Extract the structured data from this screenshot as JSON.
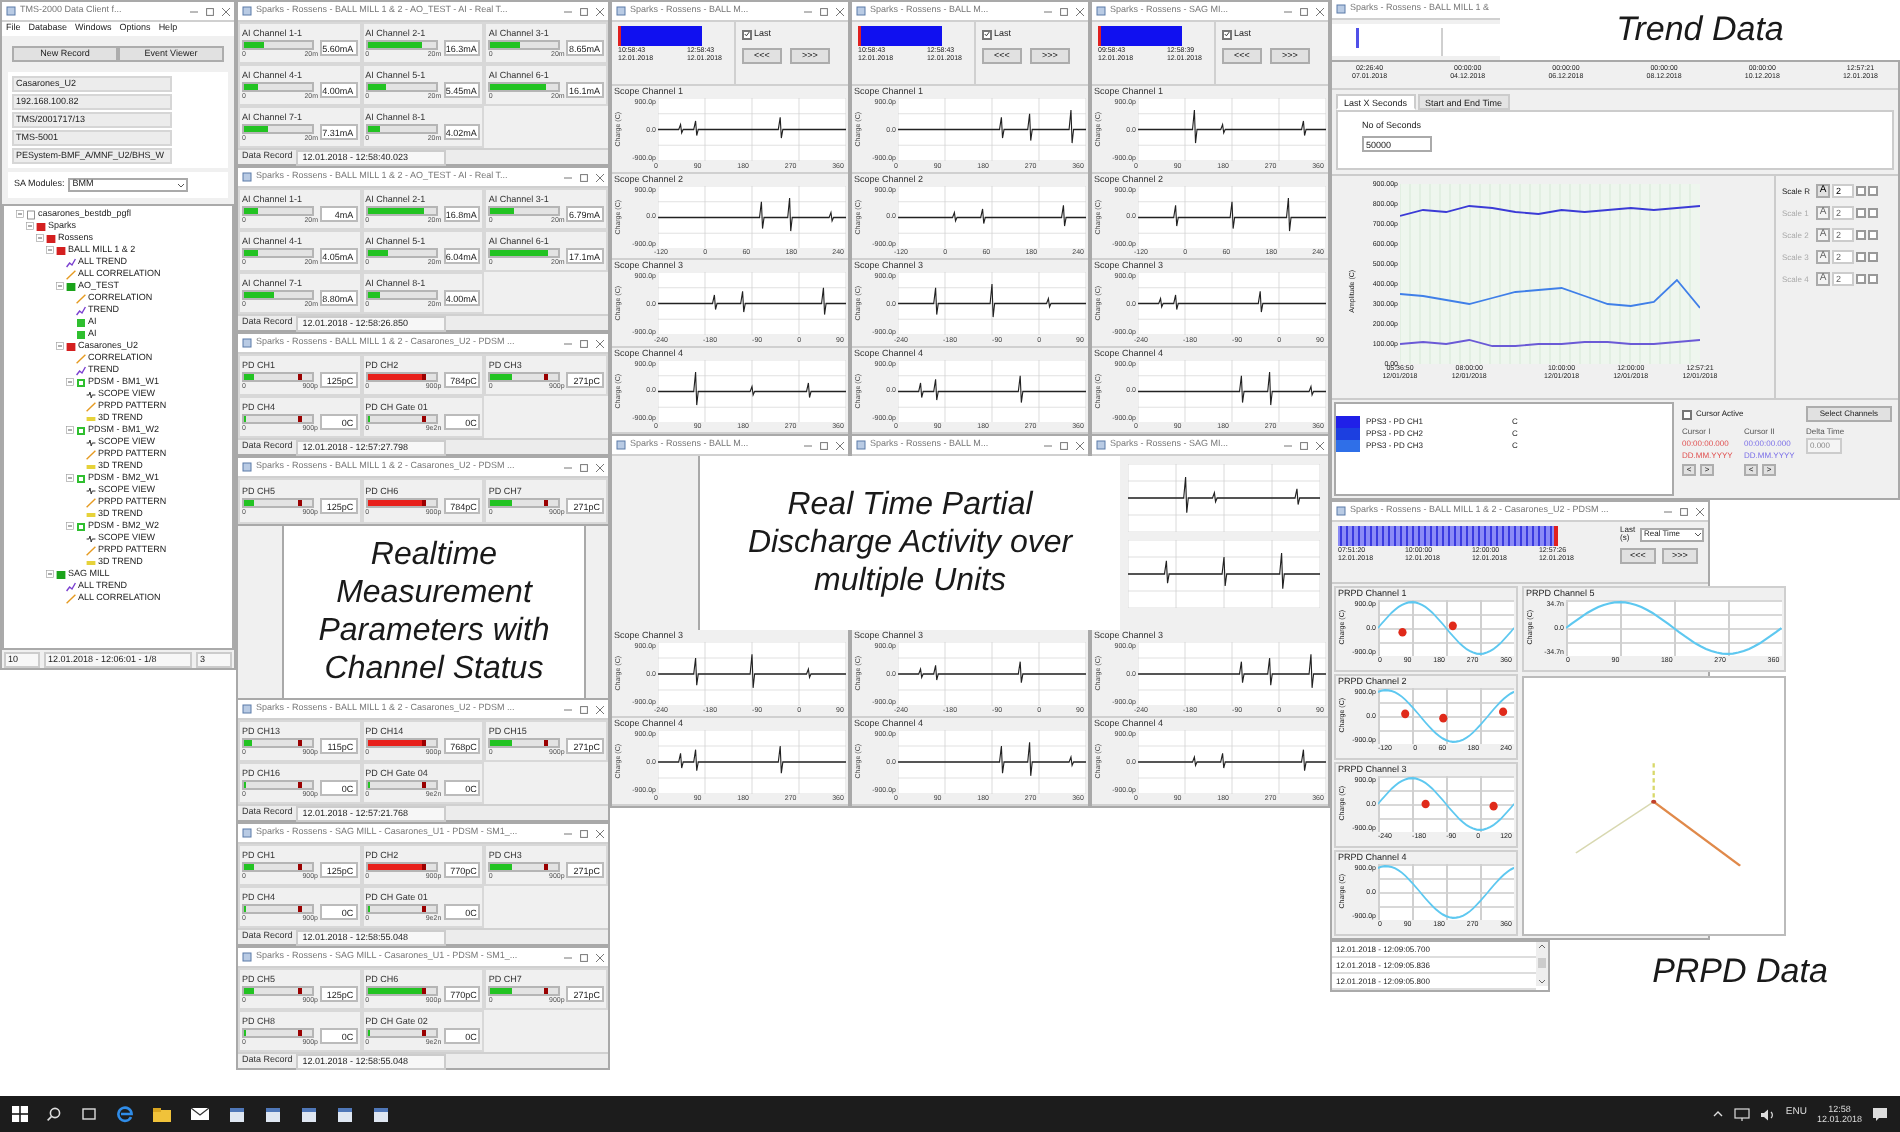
{
  "app": {
    "title": "TMS-2000 Data Client f...",
    "menu": [
      "File",
      "Database",
      "Windows",
      "Options",
      "Help"
    ],
    "buttons": [
      "New Record",
      "Event Viewer"
    ],
    "info": [
      "Casarones_U2",
      "192.168.100.82",
      "TMS/2001717/13",
      "TMS-5001",
      "PESystem-BMF_A/MNF_U2/BHS_W"
    ],
    "module_label": "SA Modules:",
    "module_value": "BMM",
    "tree": [
      {
        "label": "casarones_bestdb_pgfl",
        "kind": "db",
        "expanded": true,
        "children": [
          {
            "label": "Sparks",
            "kind": "site",
            "color": "#d41f1f",
            "expanded": true,
            "children": [
              {
                "label": "Rossens",
                "kind": "folder",
                "color": "#d41f1f",
                "expanded": true,
                "children": [
                  {
                    "label": "BALL MILL 1 & 2",
                    "kind": "unit",
                    "color": "#d41f1f",
                    "expanded": true,
                    "children": [
                      {
                        "label": "ALL TREND",
                        "kind": "trend"
                      },
                      {
                        "label": "ALL CORRELATION",
                        "kind": "correlation"
                      },
                      {
                        "label": "AO_TEST",
                        "kind": "unit",
                        "color": "#1aa31a",
                        "expanded": true,
                        "children": [
                          {
                            "label": "CORRELATION",
                            "kind": "correlation"
                          },
                          {
                            "label": "TREND",
                            "kind": "trend"
                          },
                          {
                            "label": "AI",
                            "kind": "ai"
                          },
                          {
                            "label": "AI",
                            "kind": "ai"
                          }
                        ]
                      },
                      {
                        "label": "Casarones_U2",
                        "kind": "unit",
                        "color": "#d41f1f",
                        "expanded": true,
                        "children": [
                          {
                            "label": "CORRELATION",
                            "kind": "correlation"
                          },
                          {
                            "label": "TREND",
                            "kind": "trend"
                          },
                          {
                            "label": "PDSM - BM1_W1",
                            "kind": "module",
                            "expanded": true,
                            "children": [
                              {
                                "label": "SCOPE VIEW",
                                "kind": "scope"
                              },
                              {
                                "label": "PRPD PATTERN",
                                "kind": "correlation"
                              },
                              {
                                "label": "3D TREND",
                                "kind": "trend3d"
                              }
                            ]
                          },
                          {
                            "label": "PDSM - BM1_W2",
                            "kind": "module",
                            "expanded": true,
                            "children": [
                              {
                                "label": "SCOPE VIEW",
                                "kind": "scope"
                              },
                              {
                                "label": "PRPD PATTERN",
                                "kind": "correlation"
                              },
                              {
                                "label": "3D TREND",
                                "kind": "trend3d"
                              }
                            ]
                          },
                          {
                            "label": "PDSM - BM2_W1",
                            "kind": "module",
                            "expanded": true,
                            "children": [
                              {
                                "label": "SCOPE VIEW",
                                "kind": "scope"
                              },
                              {
                                "label": "PRPD PATTERN",
                                "kind": "correlation"
                              },
                              {
                                "label": "3D TREND",
                                "kind": "trend3d"
                              }
                            ]
                          },
                          {
                            "label": "PDSM - BM2_W2",
                            "kind": "module",
                            "expanded": true,
                            "children": [
                              {
                                "label": "SCOPE VIEW",
                                "kind": "scope"
                              },
                              {
                                "label": "PRPD PATTERN",
                                "kind": "correlation"
                              },
                              {
                                "label": "3D TREND",
                                "kind": "trend3d"
                              }
                            ]
                          }
                        ]
                      }
                    ]
                  },
                  {
                    "label": "SAG MILL",
                    "kind": "unit",
                    "color": "#1aa31a",
                    "expanded": true,
                    "children": [
                      {
                        "label": "ALL TREND",
                        "kind": "trend"
                      },
                      {
                        "label": "ALL CORRELATION",
                        "kind": "correlation"
                      }
                    ]
                  }
                ]
              }
            ]
          }
        ]
      }
    ],
    "status": [
      "10",
      "12.01.2018 - 12:06:01 - 1/8",
      "3"
    ]
  },
  "ai_windows": [
    {
      "title": "Sparks - Rossens - BALL MILL 1 & 2 - AO_TEST - AI - Real T...",
      "record_label": "Data Record",
      "record": "12.01.2018 - 12:58:40.023",
      "channels": [
        {
          "name": "AI Channel 1-1",
          "min": "0",
          "max": "20m",
          "value": "5.60mA",
          "level": 0.28
        },
        {
          "name": "AI Channel 2-1",
          "min": "0",
          "max": "20m",
          "value": "16.3mA",
          "level": 0.8
        },
        {
          "name": "AI Channel 3-1",
          "min": "0",
          "max": "20m",
          "value": "8.65mA",
          "level": 0.42
        },
        {
          "name": "AI Channel 4-1",
          "min": "0",
          "max": "20m",
          "value": "4.00mA",
          "level": 0.2
        },
        {
          "name": "AI Channel 5-1",
          "min": "0",
          "max": "20m",
          "value": "5.45mA",
          "level": 0.27
        },
        {
          "name": "AI Channel 6-1",
          "min": "0",
          "max": "20m",
          "value": "16.1mA",
          "level": 0.8
        },
        {
          "name": "AI Channel 7-1",
          "min": "0",
          "max": "20m",
          "value": "7.31mA",
          "level": 0.36
        },
        {
          "name": "AI Channel 8-1",
          "min": "0",
          "max": "20m",
          "value": "4.02mA",
          "level": 0.2
        }
      ]
    },
    {
      "title": "Sparks - Rossens - BALL MILL 1 & 2 - AO_TEST - AI - Real T...",
      "record_label": "Data Record",
      "record": "12.01.2018 - 12:58:26.850",
      "channels": [
        {
          "name": "AI Channel 1-1",
          "min": "0",
          "max": "20m",
          "value": "4mA",
          "level": 0.2
        },
        {
          "name": "AI Channel 2-1",
          "min": "0",
          "max": "20m",
          "value": "16.8mA",
          "level": 0.82
        },
        {
          "name": "AI Channel 3-1",
          "min": "0",
          "max": "20m",
          "value": "6.79mA",
          "level": 0.34
        },
        {
          "name": "AI Channel 4-1",
          "min": "0",
          "max": "20m",
          "value": "4.05mA",
          "level": 0.2
        },
        {
          "name": "AI Channel 5-1",
          "min": "0",
          "max": "20m",
          "value": "6.04mA",
          "level": 0.3
        },
        {
          "name": "AI Channel 6-1",
          "min": "0",
          "max": "20m",
          "value": "17.1mA",
          "level": 0.85
        },
        {
          "name": "AI Channel 7-1",
          "min": "0",
          "max": "20m",
          "value": "8.80mA",
          "level": 0.44
        },
        {
          "name": "AI Channel 8-1",
          "min": "0",
          "max": "20m",
          "value": "4.00mA",
          "level": 0.2
        }
      ]
    }
  ],
  "pd_windows": [
    {
      "title": "Sparks - Rossens - BALL MILL 1 & 2 - Casarones_U2 - PDSM ...",
      "record_label": "Data Record",
      "record": "12.01.2018 - 12:57:27.798",
      "channels": [
        {
          "name": "PD CH1",
          "min": "0",
          "max": "900p",
          "value": "125pC",
          "level": 0.14,
          "alarm": false
        },
        {
          "name": "PD CH2",
          "min": "0",
          "max": "900p",
          "value": "784pC",
          "level": 0.85,
          "alarm": true
        },
        {
          "name": "PD CH3",
          "min": "0",
          "max": "900p",
          "value": "271pC",
          "level": 0.3,
          "alarm": false
        },
        {
          "name": "PD CH4",
          "min": "0",
          "max": "900p",
          "value": "0C",
          "level": 0.02,
          "alarm": false
        },
        {
          "name": "PD CH Gate 01",
          "min": "0",
          "max": "9e2n",
          "value": "0C",
          "level": 0.02,
          "alarm": false
        }
      ]
    },
    {
      "title": "Sparks - Rossens - BALL MILL 1 & 2 - Casarones_U2 - PDSM ...",
      "channels": [
        {
          "name": "PD CH5",
          "min": "0",
          "max": "900p",
          "value": "125pC",
          "level": 0.14,
          "alarm": false
        },
        {
          "name": "PD CH6",
          "min": "0",
          "max": "900p",
          "value": "784pC",
          "level": 0.85,
          "alarm": true
        },
        {
          "name": "PD CH7",
          "min": "0",
          "max": "900p",
          "value": "271pC",
          "level": 0.3,
          "alarm": false
        }
      ]
    },
    {
      "title": "Sparks - Rossens - BALL MILL 1 & 2 - Casarones_U2 - PDSM ...",
      "record_label": "Data Record",
      "record": "12.01.2018 - 12:57:21.768",
      "channels": [
        {
          "name": "PD CH13",
          "min": "0",
          "max": "900p",
          "value": "115pC",
          "level": 0.13,
          "alarm": false
        },
        {
          "name": "PD CH14",
          "min": "0",
          "max": "900p",
          "value": "768pC",
          "level": 0.85,
          "alarm": true
        },
        {
          "name": "PD CH15",
          "min": "0",
          "max": "900p",
          "value": "271pC",
          "level": 0.3,
          "alarm": false
        },
        {
          "name": "PD CH16",
          "min": "0",
          "max": "900p",
          "value": "0C",
          "level": 0.02,
          "alarm": false
        },
        {
          "name": "PD CH Gate 04",
          "min": "0",
          "max": "9e2n",
          "value": "0C",
          "level": 0.02,
          "alarm": false
        }
      ]
    },
    {
      "title": "Sparks - Rossens - SAG MILL - Casarones_U1 - PDSM - SM1_...",
      "record_label": "Data Record",
      "record": "12.01.2018 - 12:58:55.048",
      "channels": [
        {
          "name": "PD CH1",
          "min": "0",
          "max": "900p",
          "value": "125pC",
          "level": 0.14,
          "alarm": false
        },
        {
          "name": "PD CH2",
          "min": "0",
          "max": "900p",
          "value": "770pC",
          "level": 0.85,
          "alarm": true
        },
        {
          "name": "PD CH3",
          "min": "0",
          "max": "900p",
          "value": "271pC",
          "level": 0.3,
          "alarm": false
        },
        {
          "name": "PD CH4",
          "min": "0",
          "max": "900p",
          "value": "0C",
          "level": 0.02,
          "alarm": false
        },
        {
          "name": "PD CH Gate 01",
          "min": "0",
          "max": "9e2n",
          "value": "0C",
          "level": 0.02,
          "alarm": false
        }
      ]
    },
    {
      "title": "Sparks - Rossens - SAG MILL - Casarones_U1 - PDSM - SM1_...",
      "record_label": "Data Record",
      "record": "12.01.2018 - 12:58:55.048",
      "channels": [
        {
          "name": "PD CH5",
          "min": "0",
          "max": "900p",
          "value": "125pC",
          "level": 0.14,
          "alarm": false
        },
        {
          "name": "PD CH6",
          "min": "0",
          "max": "900p",
          "value": "770pC",
          "level": 0.85,
          "alarm": false
        },
        {
          "name": "PD CH7",
          "min": "0",
          "max": "900p",
          "value": "271pC",
          "level": 0.3,
          "alarm": false
        },
        {
          "name": "PD CH8",
          "min": "0",
          "max": "900p",
          "value": "0C",
          "level": 0.02,
          "alarm": false
        },
        {
          "name": "PD CH Gate 02",
          "min": "0",
          "max": "9e2n",
          "value": "0C",
          "level": 0.02,
          "alarm": false
        }
      ]
    }
  ],
  "realtime_callout": "Realtime Measurement Parameters with Channel Status",
  "scope_callout": "Real Time Partial Discharge Activity over multiple Units",
  "scope_windows": [
    {
      "title": "Sparks - Rossens - BALL M...",
      "start_time": "10:58:43",
      "start_date": "12.01.2018",
      "end_time": "12:58:43",
      "end_date": "12.01.2018",
      "last_label": "Last",
      "last_checked": true,
      "buttons": [
        "<<<",
        ">>>"
      ],
      "channels": [
        {
          "title": "Scope Channel 1",
          "ylabel": "Charge (C)",
          "yticks": [
            "900.0p",
            "0.0",
            "-900.0p"
          ],
          "xticks": [
            "0",
            "90",
            "180",
            "270",
            "360"
          ]
        },
        {
          "title": "Scope Channel 2",
          "ylabel": "Charge (C)",
          "yticks": [
            "900.0p",
            "0.0",
            "-900.0p"
          ],
          "xticks": [
            "-120",
            "0",
            "60",
            "180",
            "240"
          ]
        },
        {
          "title": "Scope Channel 3",
          "ylabel": "Charge (C)",
          "yticks": [
            "900.0p",
            "0.0",
            "-900.0p"
          ],
          "xticks": [
            "-240",
            "-180",
            "-90",
            "0",
            "90"
          ]
        },
        {
          "title": "Scope Channel 4",
          "ylabel": "Charge (C)",
          "yticks": [
            "900.0p",
            "0.0",
            "-900.0p"
          ],
          "xticks": [
            "0",
            "90",
            "180",
            "270",
            "360"
          ]
        }
      ]
    },
    {
      "title": "Sparks - Rossens - BALL M...",
      "start_time": "10:58:43",
      "start_date": "12.01.2018",
      "end_time": "12:58:43",
      "end_date": "12.01.2018",
      "last_label": "Last",
      "last_checked": true,
      "buttons": [
        "<<<",
        ">>>"
      ],
      "channels": [
        {
          "title": "Scope Channel 1",
          "ylabel": "Charge (C)",
          "yticks": [
            "900.0p",
            "0.0",
            "-900.0p"
          ],
          "xticks": [
            "0",
            "90",
            "180",
            "270",
            "360"
          ]
        },
        {
          "title": "Scope Channel 2",
          "ylabel": "Charge (C)",
          "yticks": [
            "900.0p",
            "0.0",
            "-900.0p"
          ],
          "xticks": [
            "-120",
            "0",
            "60",
            "180",
            "240"
          ]
        },
        {
          "title": "Scope Channel 3",
          "ylabel": "Charge (C)",
          "yticks": [
            "900.0p",
            "0.0",
            "-900.0p"
          ],
          "xticks": [
            "-240",
            "-180",
            "-90",
            "0",
            "90"
          ]
        },
        {
          "title": "Scope Channel 4",
          "ylabel": "Charge (C)",
          "yticks": [
            "900.0p",
            "0.0",
            "-900.0p"
          ],
          "xticks": [
            "0",
            "90",
            "180",
            "270",
            "360"
          ]
        }
      ]
    },
    {
      "title": "Sparks - Rossens - SAG MI...",
      "start_time": "09:58:43",
      "start_date": "12.01.2018",
      "end_time": "12:58:39",
      "end_date": "12.01.2018",
      "last_label": "Last",
      "last_checked": true,
      "buttons": [
        "<<<",
        ">>>"
      ],
      "channels": [
        {
          "title": "Scope Channel 1",
          "ylabel": "Charge (C)",
          "yticks": [
            "900.0p",
            "0.0",
            "-900.0p"
          ],
          "xticks": [
            "0",
            "90",
            "180",
            "270",
            "360"
          ]
        },
        {
          "title": "Scope Channel 2",
          "ylabel": "Charge (C)",
          "yticks": [
            "900.0p",
            "0.0",
            "-900.0p"
          ],
          "xticks": [
            "-120",
            "0",
            "60",
            "180",
            "240"
          ]
        },
        {
          "title": "Scope Channel 3",
          "ylabel": "Charge (C)",
          "yticks": [
            "900.0p",
            "0.0",
            "-900.0p"
          ],
          "xticks": [
            "-240",
            "-180",
            "-90",
            "0",
            "90"
          ]
        },
        {
          "title": "Scope Channel 4",
          "ylabel": "Charge (C)",
          "yticks": [
            "900.0p",
            "0.0",
            "-900.0p"
          ],
          "xticks": [
            "0",
            "90",
            "180",
            "270",
            "360"
          ]
        }
      ]
    }
  ],
  "scope_windows_lower": [
    {
      "title": "Sparks - Rossens - BALL M...",
      "channels": [
        {
          "title": "Scope Channel 3",
          "ylabel": "Charge (C)",
          "yticks": [
            "900.0p",
            "0.0",
            "-900.0p"
          ],
          "xticks": [
            "-240",
            "-180",
            "-90",
            "0",
            "90"
          ]
        },
        {
          "title": "Scope Channel 4",
          "ylabel": "Charge (C)",
          "yticks": [
            "900.0p",
            "0.0",
            "-900.0p"
          ],
          "xticks": [
            "0",
            "90",
            "180",
            "270",
            "360"
          ]
        }
      ]
    },
    {
      "title": "Sparks - Rossens - BALL M...",
      "channels": [
        {
          "title": "Scope Channel 3",
          "ylabel": "Charge (C)",
          "yticks": [
            "900.0p",
            "0.0",
            "-900.0p"
          ],
          "xticks": [
            "-240",
            "-180",
            "-90",
            "0",
            "90"
          ]
        },
        {
          "title": "Scope Channel 4",
          "ylabel": "Charge (C)",
          "yticks": [
            "900.0p",
            "0.0",
            "-900.0p"
          ],
          "xticks": [
            "0",
            "90",
            "180",
            "270",
            "360"
          ]
        }
      ]
    },
    {
      "title": "Sparks - Rossens - SAG MI...",
      "channels": [
        {
          "title": "Scope Channel 3",
          "ylabel": "Charge (C)",
          "yticks": [
            "900.0p",
            "0.0",
            "-900.0p"
          ],
          "xticks": [
            "-240",
            "-180",
            "-90",
            "0",
            "90"
          ]
        },
        {
          "title": "Scope Channel 4",
          "ylabel": "Charge (C)",
          "yticks": [
            "900.0p",
            "0.0",
            "-900.0p"
          ],
          "xticks": [
            "0",
            "90",
            "180",
            "270",
            "360"
          ]
        }
      ]
    }
  ],
  "trend": {
    "title": "Sparks - Rossens - BALL MILL 1 &",
    "callout": "Trend Data",
    "time_labels": [
      {
        "time": "02:26:40",
        "date": "07.01.2018"
      },
      {
        "time": "00:00:00",
        "date": "04.12.2018"
      },
      {
        "time": "00:00:00",
        "date": "06.12.2018"
      },
      {
        "time": "00:00:00",
        "date": "08.12.2018"
      },
      {
        "time": "00:00:00",
        "date": "10.12.2018"
      },
      {
        "time": "12:57:21",
        "date": "12.01.2018"
      }
    ],
    "tabs": [
      {
        "label": "Last X Seconds",
        "selected": true
      },
      {
        "label": "Start and End Time",
        "selected": false
      }
    ],
    "seconds_label": "No of Seconds",
    "seconds_value": "50000",
    "chart_data": {
      "type": "line",
      "grid": true,
      "ylabel": "Amplitude (C)",
      "categories": [
        "05:36:50 12/01/2018",
        null,
        null,
        "08:00:00 12/01/2018",
        null,
        null,
        null,
        "10:00:00 12/01/2018",
        null,
        null,
        "12:00:00 12/01/2018",
        null,
        null,
        "12:57:21 12/01/2018"
      ],
      "ylim": [
        0,
        900
      ],
      "yticks": [
        {
          "value": 900,
          "label": "900.00p"
        },
        {
          "value": 800,
          "label": "800.00p"
        },
        {
          "value": 700,
          "label": "700.00p"
        },
        {
          "value": 600,
          "label": "600.00p"
        },
        {
          "value": 500,
          "label": "500.00p"
        },
        {
          "value": 400,
          "label": "400.00p"
        },
        {
          "value": 300,
          "label": "300.00p"
        },
        {
          "value": 200,
          "label": "200.00p"
        },
        {
          "value": 100,
          "label": "100.00p"
        },
        {
          "value": 0,
          "label": "0.00"
        }
      ],
      "series": [
        {
          "name": "PPS3 - PD CH1",
          "color": "#3b3bd6",
          "values": [
            740,
            770,
            760,
            790,
            780,
            760,
            750,
            770,
            760,
            770,
            780,
            770,
            780,
            790
          ]
        },
        {
          "name": "PPS3 - PD CH2",
          "color": "#3f7fe8",
          "values": [
            350,
            340,
            320,
            300,
            330,
            360,
            370,
            380,
            340,
            300,
            290,
            310,
            420,
            280
          ]
        },
        {
          "name": "PPS3 - PD CH3",
          "color": "#6a5ad6",
          "values": [
            100,
            110,
            100,
            120,
            90,
            90,
            100,
            100,
            110,
            110,
            100,
            100,
            110,
            120
          ]
        }
      ]
    },
    "scales": [
      {
        "label": "Scale R",
        "button": "A",
        "value": "2",
        "disabled": false,
        "checks": [
          false,
          false
        ]
      },
      {
        "label": "Scale 1",
        "button": "A",
        "value": "2",
        "disabled": true,
        "checks": [
          false,
          false
        ]
      },
      {
        "label": "Scale 2",
        "button": "A",
        "value": "2",
        "disabled": true,
        "checks": [
          false,
          false
        ]
      },
      {
        "label": "Scale 3",
        "button": "A",
        "value": "2",
        "disabled": true,
        "checks": [
          false,
          false
        ]
      },
      {
        "label": "Scale 4",
        "button": "A",
        "value": "2",
        "disabled": true,
        "checks": [
          false,
          false
        ]
      }
    ],
    "legend": [
      {
        "unit": "C",
        "color": "#2020e8"
      },
      {
        "unit": "C",
        "color": "#1c3fe0"
      },
      {
        "unit": "C",
        "color": "#2f6fe8"
      }
    ],
    "cursor_active": {
      "label": "Cursor Active",
      "checked": false
    },
    "select_button": "Select Channels",
    "cursors": [
      {
        "label": "Cursor I",
        "time": "00:00:00.000",
        "date": "DD.MM.YYYY",
        "buttons": [
          "<",
          ">"
        ]
      },
      {
        "label": "Cursor II",
        "time": "00:00:00.000",
        "date": "DD.MM.YYYY",
        "buttons": [
          "<",
          ">"
        ]
      }
    ],
    "delta_label": "Delta Time",
    "delta_value": "0.000"
  },
  "prpd": {
    "title": "Sparks - Rossens - BALL MILL 1 & 2 - Casarones_U2 - PDSM ...",
    "callout": "PRPD Data",
    "time_labels": [
      {
        "time": "07:51:20",
        "date": "12.01.2018"
      },
      {
        "time": "10:00:00",
        "date": "12.01.2018"
      },
      {
        "time": "12:00:00",
        "date": "12.01.2018"
      },
      {
        "time": "12:57:26",
        "date": "12.01.2018"
      }
    ],
    "last_label": "Last (s)",
    "mode": "Real Time",
    "buttons": [
      "<<<",
      ">>>"
    ],
    "left_channels": [
      {
        "title": "PRPD Channel 1",
        "ylabel": "Charge (C)",
        "yticks": [
          "900.0p",
          "0.0",
          "-900.0p"
        ],
        "xticks": [
          "0",
          "90",
          "180",
          "270",
          "360"
        ]
      },
      {
        "title": "PRPD Channel 2",
        "ylabel": "Charge (C)",
        "yticks": [
          "900.0p",
          "0.0",
          "-900.0p"
        ],
        "xticks": [
          "-120",
          "0",
          "60",
          "180",
          "240"
        ]
      },
      {
        "title": "PRPD Channel 3",
        "ylabel": "Charge (C)",
        "yticks": [
          "900.0p",
          "0.0",
          "-900.0p"
        ],
        "xticks": [
          "-240",
          "-180",
          "-90",
          "0",
          "120"
        ]
      },
      {
        "title": "PRPD Channel 4",
        "ylabel": "Charge (C)",
        "yticks": [
          "900.0p",
          "0.0",
          "-900.0p"
        ],
        "xticks": [
          "0",
          "90",
          "180",
          "270",
          "360"
        ]
      }
    ],
    "right_channel": {
      "title": "PRPD Channel 5",
      "ylabel": "Charge (C)",
      "yticks": [
        "34.7n",
        "0.0",
        "-34.7n"
      ],
      "xticks": [
        "0",
        "90",
        "180",
        "270",
        "360"
      ]
    },
    "records": [
      "12.01.2018 - 12:09:05.700",
      "12.01.2018 - 12:09:05.836",
      "12.01.2018 - 12:09:05.800"
    ]
  },
  "taskbar": {
    "language": "ENU",
    "time": "12:58",
    "date": "12.01.2018"
  }
}
